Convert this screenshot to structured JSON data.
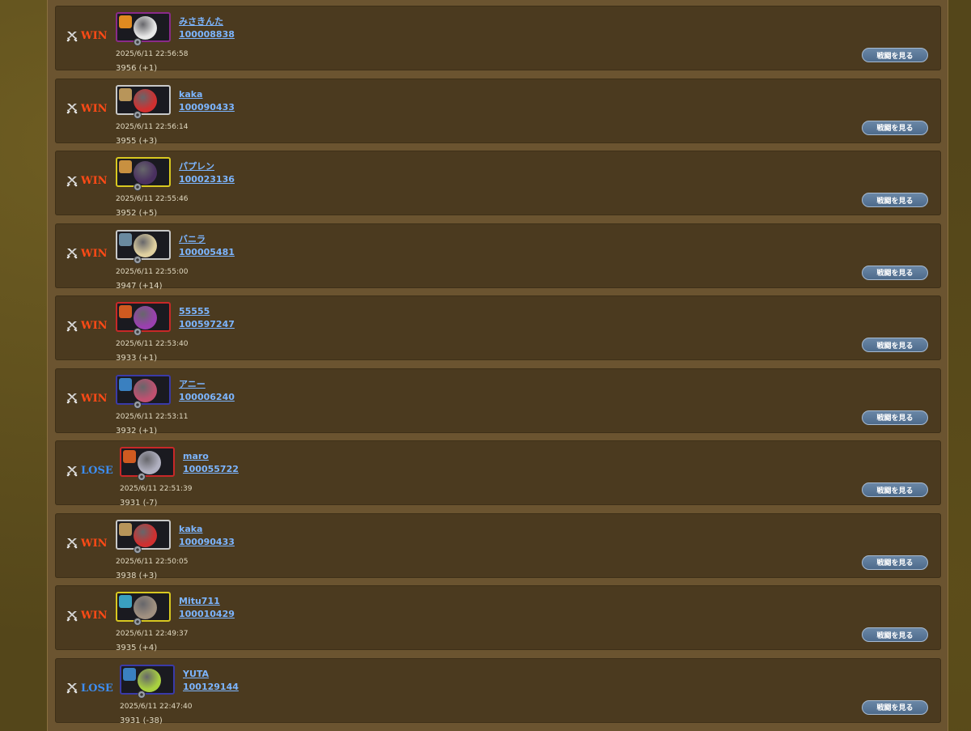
{
  "button_label": "戦闘を見る",
  "colors": {
    "win": "#ff4a16",
    "lose": "#3d8df0",
    "link": "#7cb5ff"
  },
  "battles": [
    {
      "result": "WIN",
      "name": "みさきんた",
      "id": "100008838",
      "datetime": "2025/6/11 22:56:58",
      "score": "3956 (+1)",
      "frame": "#8a2a8a",
      "circle": "#e8e8e8",
      "tag": "#e08a20"
    },
    {
      "result": "WIN",
      "name": "kaka",
      "id": "100090433",
      "datetime": "2025/6/11 22:56:14",
      "score": "3955 (+3)",
      "frame": "#c8c8c8",
      "circle": "#d03030",
      "tag": "#b8955a"
    },
    {
      "result": "WIN",
      "name": "パプレン",
      "id": "100023136",
      "datetime": "2025/6/11 22:55:46",
      "score": "3952 (+5)",
      "frame": "#d8c820",
      "circle": "#4a3060",
      "tag": "#c89040"
    },
    {
      "result": "WIN",
      "name": "バニラ",
      "id": "100005481",
      "datetime": "2025/6/11 22:55:00",
      "score": "3947 (+14)",
      "frame": "#c8c8c8",
      "circle": "#e0d0a0",
      "tag": "#6a8aa0"
    },
    {
      "result": "WIN",
      "name": "55555",
      "id": "100597247",
      "datetime": "2025/6/11 22:53:40",
      "score": "3933 (+1)",
      "frame": "#c82828",
      "circle": "#9a40b0",
      "tag": "#d05a20"
    },
    {
      "result": "WIN",
      "name": "アニー",
      "id": "100006240",
      "datetime": "2025/6/11 22:53:11",
      "score": "3932 (+1)",
      "frame": "#3a3aa8",
      "circle": "#c05070",
      "tag": "#3a80c0"
    },
    {
      "result": "LOSE",
      "name": "maro",
      "id": "100055722",
      "datetime": "2025/6/11 22:51:39",
      "score": "3931 (-7)",
      "frame": "#c82828",
      "circle": "#b0b0c0",
      "tag": "#d05a20"
    },
    {
      "result": "WIN",
      "name": "kaka",
      "id": "100090433",
      "datetime": "2025/6/11 22:50:05",
      "score": "3938 (+3)",
      "frame": "#c8c8c8",
      "circle": "#d03030",
      "tag": "#b8955a"
    },
    {
      "result": "WIN",
      "name": "Mitu711",
      "id": "100010429",
      "datetime": "2025/6/11 22:49:37",
      "score": "3935 (+4)",
      "frame": "#d8c820",
      "circle": "#a09080",
      "tag": "#3aa0c0"
    },
    {
      "result": "LOSE",
      "name": "YUTA",
      "id": "100129144",
      "datetime": "2025/6/11 22:47:40",
      "score": "3931 (-38)",
      "frame": "#3a3aa8",
      "circle": "#a8d040",
      "tag": "#3a80c0"
    }
  ]
}
